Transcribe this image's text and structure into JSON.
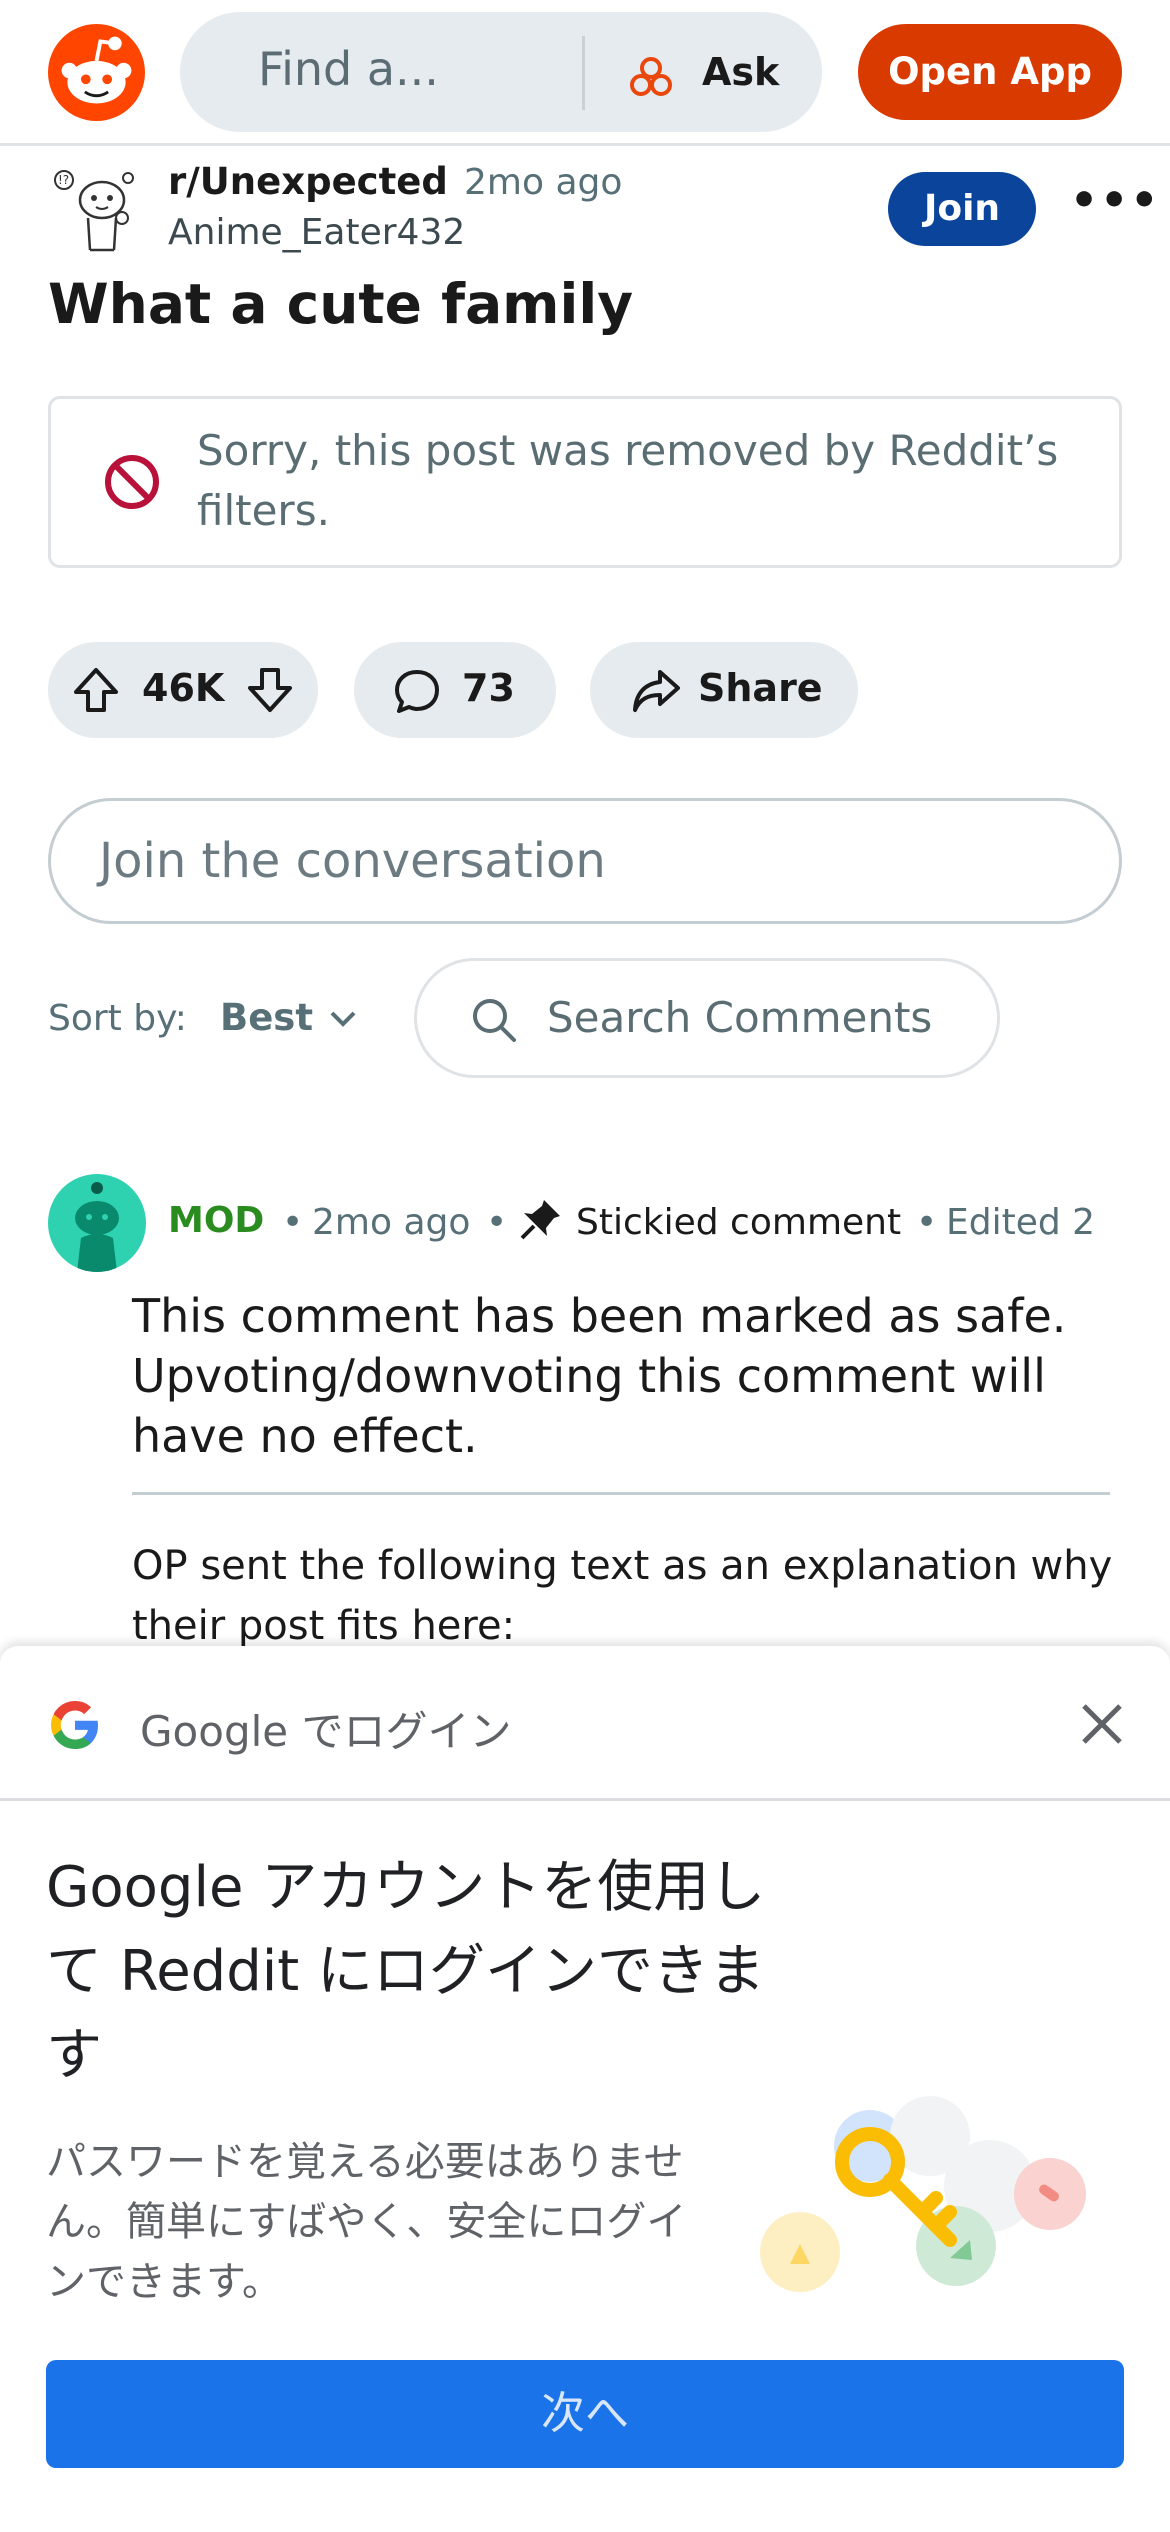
{
  "header": {
    "search_placeholder": "Find a...",
    "ask_label": "Ask",
    "open_app_label": "Open App",
    "brand_color": "#ff4500"
  },
  "post": {
    "subreddit": "r/Unexpected",
    "time": "2mo ago",
    "author": "Anime_Eater432",
    "join_label": "Join",
    "more_label": "•••",
    "title": "What a cute family",
    "removed_message": "Sorry, this post was removed by Reddit’s filters.",
    "votes": "46K",
    "comments": "73",
    "share_label": "Share"
  },
  "comments_section": {
    "join_placeholder": "Join the conversation",
    "sort_label": "Sort by:",
    "sort_value": "Best",
    "search_placeholder": "Search Comments"
  },
  "comment": {
    "author": "MOD",
    "sep1": "•",
    "time": "2mo ago",
    "sep2": "•",
    "stickied": "Stickied comment",
    "sep3": "•",
    "edited": "Edited 2",
    "text": "This comment has been marked as safe. Upvoting/downvoting this comment will have no effect.",
    "text2": "OP sent the following text as an explanation why their post fits here:"
  },
  "google_sheet": {
    "title": "Google でログイン",
    "headline": "Google アカウントを使用して Reddit にログインできます",
    "body": "パスワードを覚える必要はありません。簡単にすばやく、安全にログインできます。",
    "next_label": "次へ",
    "button_color": "#1a73e8"
  }
}
